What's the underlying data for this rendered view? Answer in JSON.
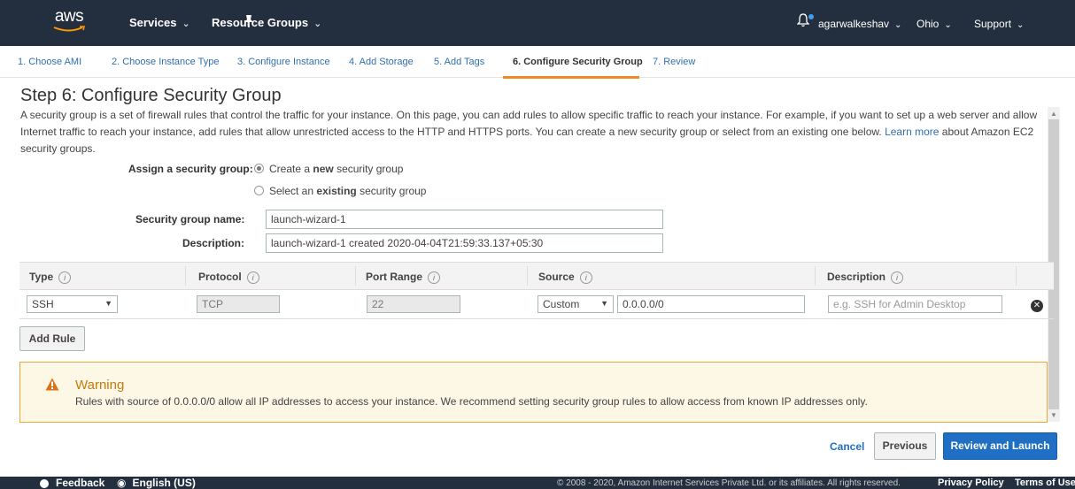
{
  "nav": {
    "logo": "aws",
    "services": "Services",
    "resource_groups": "Resource Groups",
    "user": "agarwalkeshav",
    "region": "Ohio",
    "support": "Support"
  },
  "tabs": [
    {
      "label": "1. Choose AMI"
    },
    {
      "label": "2. Choose Instance Type"
    },
    {
      "label": "3. Configure Instance"
    },
    {
      "label": "4. Add Storage"
    },
    {
      "label": "5. Add Tags"
    },
    {
      "label": "6. Configure Security Group"
    },
    {
      "label": "7. Review"
    }
  ],
  "page": {
    "title": "Step 6: Configure Security Group",
    "intro": "A security group is a set of firewall rules that control the traffic for your instance. On this page, you can add rules to allow specific traffic to reach your instance. For example, if you want to set up a web server and allow Internet traffic to reach your instance, add rules that allow unrestricted access to the HTTP and HTTPS ports. You can create a new security group or select from an existing one below.",
    "learn_more": "Learn more",
    "intro_tail": "about Amazon EC2 security groups."
  },
  "form": {
    "assign_label": "Assign a security group:",
    "option_new_pre": "Create a",
    "option_new_bold": "new",
    "option_new_post": "security group",
    "option_existing_pre": "Select an",
    "option_existing_bold": "existing",
    "option_existing_post": "security group",
    "name_label": "Security group name:",
    "name_value": "launch-wizard-1",
    "desc_label": "Description:",
    "desc_value": "launch-wizard-1 created 2020-04-04T21:59:33.137+05:30"
  },
  "table": {
    "headers": [
      "Type",
      "Protocol",
      "Port Range",
      "Source",
      "Description"
    ],
    "info_glyph": "i",
    "row": {
      "type": "SSH",
      "protocol": "TCP",
      "port_range": "22",
      "source_type": "Custom",
      "source_value": "0.0.0.0/0",
      "description_placeholder": "e.g. SSH for Admin Desktop"
    },
    "add_rule": "Add Rule"
  },
  "warning": {
    "title": "Warning",
    "text": "Rules with source of 0.0.0.0/0 allow all IP addresses to access your instance. We recommend setting security group rules to allow access from known IP addresses only."
  },
  "actions": {
    "cancel": "Cancel",
    "previous": "Previous",
    "review_launch": "Review and Launch"
  },
  "footer": {
    "feedback": "Feedback",
    "language": "English (US)",
    "copyright": "© 2008 - 2020, Amazon Internet Services Private Ltd. or its affiliates. All rights reserved.",
    "privacy": "Privacy Policy",
    "terms": "Terms of Use"
  },
  "colors": {
    "nav_bg": "#232f3e",
    "tab_accent": "#f08a24",
    "primary": "#1f6fc5",
    "warning_border": "#e8a93a",
    "warning_title": "#c27b0e"
  }
}
